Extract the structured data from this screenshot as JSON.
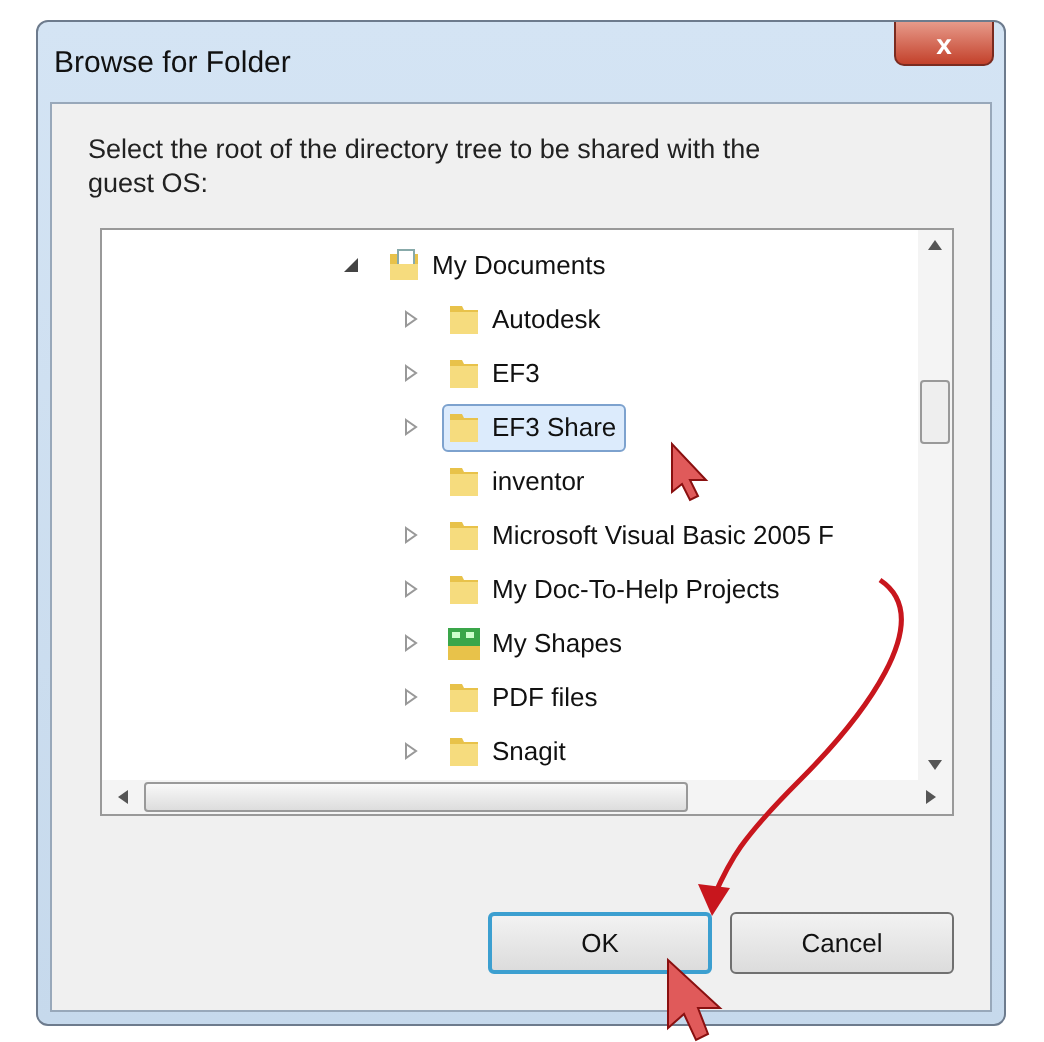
{
  "window": {
    "title": "Browse for Folder",
    "close": "x"
  },
  "instruction": "Select the root of the directory tree to be shared with the guest OS:",
  "tree": [
    {
      "label": "My Documents",
      "kind": "documents",
      "expandable": true,
      "expanded": true,
      "selected": false,
      "children": [
        {
          "label": "Autodesk",
          "kind": "folder",
          "expandable": true,
          "selected": false
        },
        {
          "label": "EF3",
          "kind": "folder",
          "expandable": true,
          "selected": false
        },
        {
          "label": "EF3 Share",
          "kind": "folder",
          "expandable": true,
          "selected": true
        },
        {
          "label": "inventor",
          "kind": "folder",
          "expandable": false,
          "selected": false
        },
        {
          "label": "Microsoft Visual Basic 2005 F",
          "kind": "folder",
          "expandable": true,
          "selected": false
        },
        {
          "label": "My Doc-To-Help Projects",
          "kind": "folder",
          "expandable": true,
          "selected": false
        },
        {
          "label": "My Shapes",
          "kind": "shapes",
          "expandable": true,
          "selected": false
        },
        {
          "label": "PDF files",
          "kind": "folder",
          "expandable": true,
          "selected": false
        },
        {
          "label": "Snagit",
          "kind": "folder",
          "expandable": true,
          "selected": false
        }
      ]
    }
  ],
  "buttons": [
    {
      "label": "OK",
      "default": true
    },
    {
      "label": "Cancel",
      "default": false
    }
  ]
}
